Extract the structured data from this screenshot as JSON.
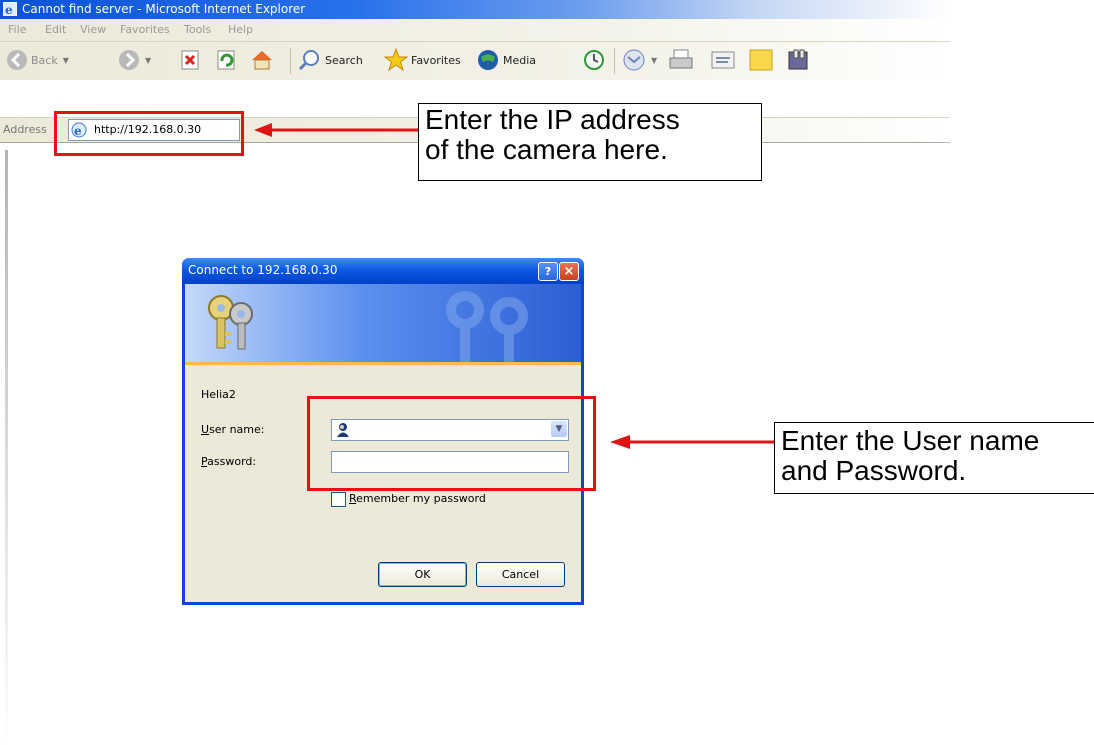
{
  "window": {
    "title": "Cannot find server - Microsoft Internet Explorer",
    "menu": [
      "File",
      "Edit",
      "View",
      "Favorites",
      "Tools",
      "Help"
    ],
    "toolbar": {
      "back_label": "Back",
      "search_label": "Search",
      "favorites_label": "Favorites",
      "media_label": "Media"
    },
    "address": {
      "label": "Address",
      "url": "http://192.168.0.30"
    }
  },
  "dialog": {
    "title": "Connect to 192.168.0.30",
    "help_glyph": "?",
    "close_glyph": "×",
    "server_name": "Helia2",
    "user_label_first": "U",
    "user_label_rest": "ser name:",
    "password_label_first": "P",
    "password_label_rest": "assword:",
    "user_value": "",
    "password_value": "",
    "remember_first": "R",
    "remember_rest": "emember my password",
    "remember_checked": false,
    "ok_label": "OK",
    "cancel_label": "Cancel"
  },
  "annotations": {
    "address_note": [
      "Enter the IP address",
      "of the camera here."
    ],
    "login_note": [
      "Enter the User name",
      "and Password."
    ],
    "highlight_color": "#e11414"
  },
  "colors": {
    "title_blue": "#0a52d6",
    "chrome": "#ece9d8",
    "dialog_frame": "#0a46d8"
  }
}
